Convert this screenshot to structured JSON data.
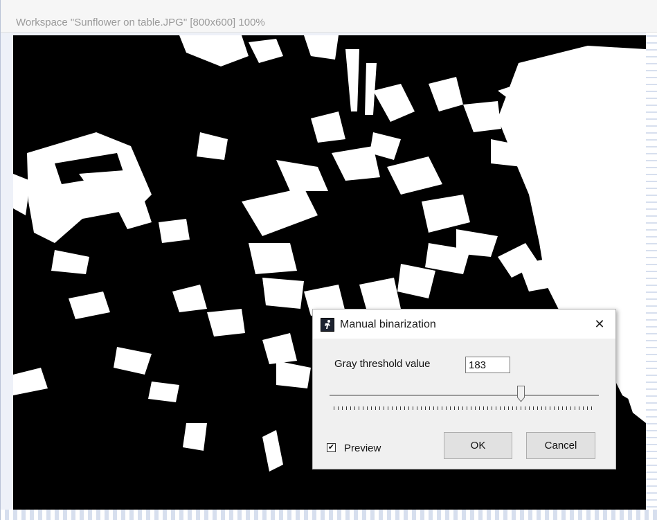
{
  "workspace": {
    "title": "Workspace \"Sunflower on table.JPG\"  [800x600] 100%",
    "image": "binarized sunflowers photo (black and white)"
  },
  "dialog": {
    "title": "Manual binarization",
    "close_glyph": "✕",
    "threshold_label": "Gray threshold value",
    "threshold_value": "183",
    "slider": {
      "value": 183,
      "min": 0,
      "max": 255
    },
    "preview_label": "Preview",
    "preview_checked": true,
    "ok_label": "OK",
    "cancel_label": "Cancel"
  },
  "icons": {
    "app": "app-window-icon",
    "close": "close-icon",
    "check": "checkmark-icon"
  },
  "colors": {
    "background": "#eef1f8",
    "dialog_bg": "#f0f0f0",
    "button_bg": "#e1e1e1"
  }
}
